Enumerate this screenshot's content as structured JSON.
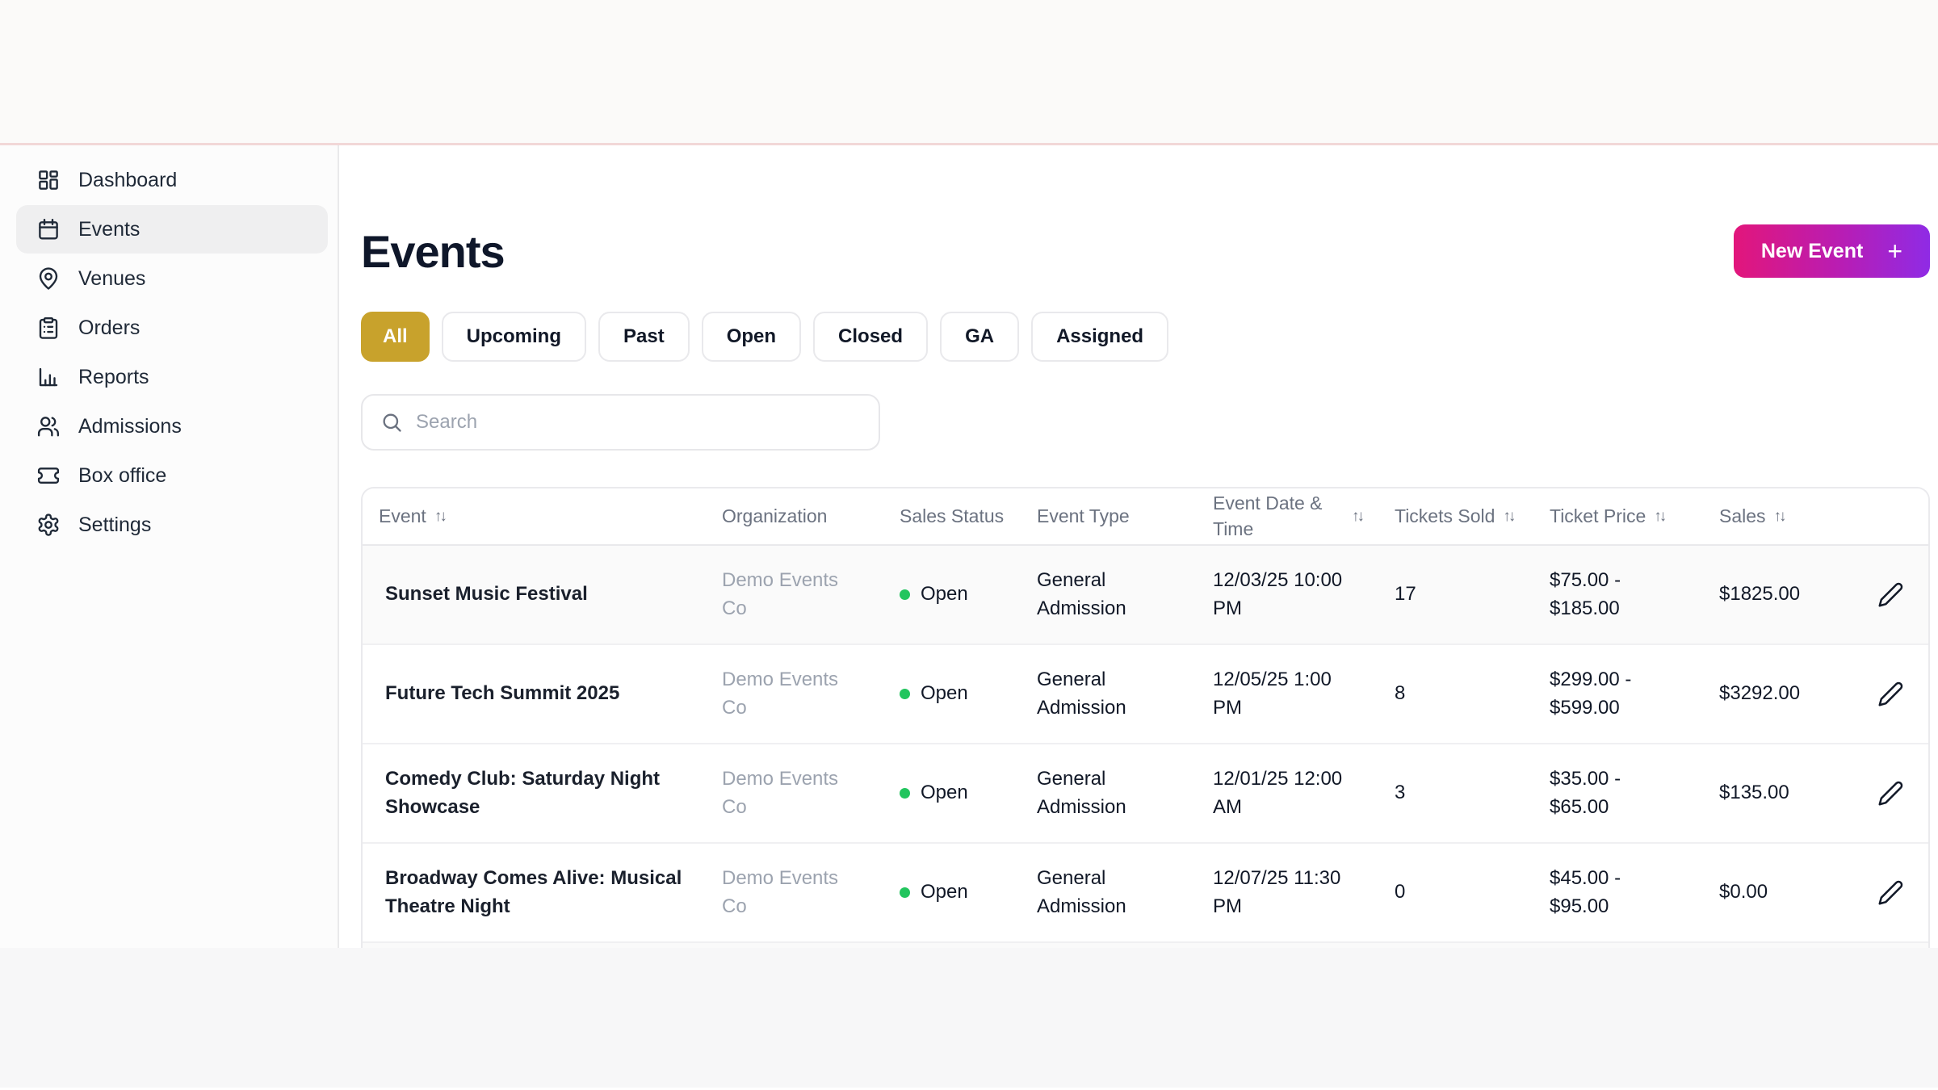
{
  "colors": {
    "accent_gold": "#C8A22C",
    "gradient_start": "#E2167B",
    "gradient_end": "#8F2BE5",
    "status_open_green": "#22C55E"
  },
  "sidebar": {
    "items": [
      {
        "label": "Dashboard",
        "icon": "dashboard-icon",
        "active": false
      },
      {
        "label": "Events",
        "icon": "calendar-icon",
        "active": true
      },
      {
        "label": "Venues",
        "icon": "map-pin-icon",
        "active": false
      },
      {
        "label": "Orders",
        "icon": "clipboard-icon",
        "active": false
      },
      {
        "label": "Reports",
        "icon": "bar-chart-icon",
        "active": false
      },
      {
        "label": "Admissions",
        "icon": "users-icon",
        "active": false
      },
      {
        "label": "Box office",
        "icon": "ticket-icon",
        "active": false
      },
      {
        "label": "Settings",
        "icon": "gear-icon",
        "active": false
      }
    ]
  },
  "header": {
    "title": "Events",
    "new_event_label": "New Event",
    "plus": "+"
  },
  "filters": {
    "options": [
      {
        "label": "All",
        "active": true
      },
      {
        "label": "Upcoming",
        "active": false
      },
      {
        "label": "Past",
        "active": false
      },
      {
        "label": "Open",
        "active": false
      },
      {
        "label": "Closed",
        "active": false
      },
      {
        "label": "GA",
        "active": false
      },
      {
        "label": "Assigned",
        "active": false
      }
    ]
  },
  "search": {
    "placeholder": "Search"
  },
  "table": {
    "columns": [
      {
        "label": "Event",
        "sortable": true
      },
      {
        "label": "Organization",
        "sortable": false
      },
      {
        "label": "Sales Status",
        "sortable": false
      },
      {
        "label": "Event Type",
        "sortable": false
      },
      {
        "label": "Event Date & Time",
        "sortable": true
      },
      {
        "label": "Tickets Sold",
        "sortable": true
      },
      {
        "label": "Ticket Price",
        "sortable": true
      },
      {
        "label": "Sales",
        "sortable": true
      },
      {
        "label": "",
        "sortable": false
      }
    ],
    "rows": [
      {
        "event": "Sunset Music Festival",
        "organization": "Demo Events Co",
        "sales_status": "Open",
        "event_type": "General Admission",
        "date_time": "12/03/25 10:00 PM",
        "tickets_sold": "17",
        "ticket_price": "$75.00 - $185.00",
        "sales": "$1825.00",
        "shade": true
      },
      {
        "event": "Future Tech Summit 2025",
        "organization": "Demo Events Co",
        "sales_status": "Open",
        "event_type": "General Admission",
        "date_time": "12/05/25 1:00 PM",
        "tickets_sold": "8",
        "ticket_price": "$299.00 - $599.00",
        "sales": "$3292.00",
        "shade": false
      },
      {
        "event": "Comedy Club: Saturday Night Showcase",
        "organization": "Demo Events Co",
        "sales_status": "Open",
        "event_type": "General Admission",
        "date_time": "12/01/25 12:00 AM",
        "tickets_sold": "3",
        "ticket_price": "$35.00 - $65.00",
        "sales": "$135.00",
        "shade": false
      },
      {
        "event": "Broadway Comes Alive: Musical Theatre Night",
        "organization": "Demo Events Co",
        "sales_status": "Open",
        "event_type": "General Admission",
        "date_time": "12/07/25 11:30 PM",
        "tickets_sold": "0",
        "ticket_price": "$45.00 - $95.00",
        "sales": "$0.00",
        "shade": false
      }
    ]
  }
}
